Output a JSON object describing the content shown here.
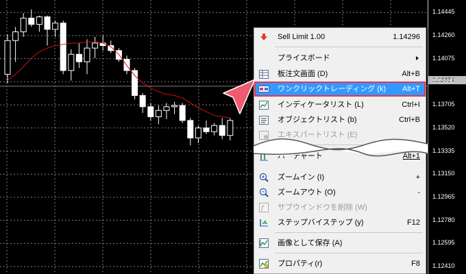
{
  "price_axis": {
    "ticks": [
      "1.14445",
      "1.14260",
      "1.14075",
      "1.13890",
      "1.13705",
      "1.13520",
      "1.13335",
      "1.13150",
      "1.12965",
      "1.12780",
      "1.12595",
      "1.12410"
    ],
    "current_price": "1.13854"
  },
  "chart_data": {
    "type": "candlestick",
    "candles": [
      {
        "o": 1.1395,
        "h": 1.1427,
        "l": 1.1388,
        "c": 1.1422
      },
      {
        "o": 1.1422,
        "h": 1.1433,
        "l": 1.1405,
        "c": 1.1429
      },
      {
        "o": 1.1429,
        "h": 1.1444,
        "l": 1.1425,
        "c": 1.144
      },
      {
        "o": 1.144,
        "h": 1.1447,
        "l": 1.1433,
        "c": 1.1435
      },
      {
        "o": 1.1435,
        "h": 1.1442,
        "l": 1.1429,
        "c": 1.1441
      },
      {
        "o": 1.1441,
        "h": 1.1442,
        "l": 1.1418,
        "c": 1.1431
      },
      {
        "o": 1.1431,
        "h": 1.1438,
        "l": 1.1425,
        "c": 1.1436
      },
      {
        "o": 1.1436,
        "h": 1.1438,
        "l": 1.1395,
        "c": 1.1398
      },
      {
        "o": 1.1398,
        "h": 1.1415,
        "l": 1.139,
        "c": 1.1411
      },
      {
        "o": 1.1411,
        "h": 1.142,
        "l": 1.14,
        "c": 1.1405
      },
      {
        "o": 1.1405,
        "h": 1.1423,
        "l": 1.1395,
        "c": 1.1416
      },
      {
        "o": 1.1416,
        "h": 1.1425,
        "l": 1.1408,
        "c": 1.142
      },
      {
        "o": 1.142,
        "h": 1.1426,
        "l": 1.1414,
        "c": 1.1418
      },
      {
        "o": 1.1418,
        "h": 1.1422,
        "l": 1.1412,
        "c": 1.1414
      },
      {
        "o": 1.1414,
        "h": 1.1416,
        "l": 1.1405,
        "c": 1.1407
      },
      {
        "o": 1.1407,
        "h": 1.141,
        "l": 1.1395,
        "c": 1.1398
      },
      {
        "o": 1.1398,
        "h": 1.14,
        "l": 1.1375,
        "c": 1.1378
      },
      {
        "o": 1.1378,
        "h": 1.138,
        "l": 1.1364,
        "c": 1.1369
      },
      {
        "o": 1.1369,
        "h": 1.1372,
        "l": 1.1358,
        "c": 1.1361
      },
      {
        "o": 1.1361,
        "h": 1.137,
        "l": 1.1355,
        "c": 1.1366
      },
      {
        "o": 1.1366,
        "h": 1.1372,
        "l": 1.1359,
        "c": 1.1369
      },
      {
        "o": 1.1369,
        "h": 1.1373,
        "l": 1.1363,
        "c": 1.137
      },
      {
        "o": 1.137,
        "h": 1.1372,
        "l": 1.1356,
        "c": 1.1358
      },
      {
        "o": 1.1358,
        "h": 1.136,
        "l": 1.1338,
        "c": 1.1344
      },
      {
        "o": 1.1344,
        "h": 1.1354,
        "l": 1.134,
        "c": 1.1352
      },
      {
        "o": 1.1352,
        "h": 1.1358,
        "l": 1.1347,
        "c": 1.1349
      },
      {
        "o": 1.1349,
        "h": 1.1356,
        "l": 1.1346,
        "c": 1.1354
      },
      {
        "o": 1.1354,
        "h": 1.136,
        "l": 1.1343,
        "c": 1.1346
      },
      {
        "o": 1.1346,
        "h": 1.136,
        "l": 1.1342,
        "c": 1.1358
      }
    ],
    "moving_average": [
      1.139,
      1.1395,
      1.1401,
      1.1408,
      1.1413,
      1.1416,
      1.1418,
      1.1419,
      1.142,
      1.142,
      1.1421,
      1.1421,
      1.142,
      1.1417,
      1.1411,
      1.1402,
      1.1394,
      1.1388,
      1.1384,
      1.1381,
      1.1379,
      1.1378,
      1.1376,
      1.1372,
      1.1368,
      1.1365,
      1.1362,
      1.1361,
      1.136
    ],
    "ylim": [
      1.1235,
      1.14545
    ],
    "grid": true
  },
  "colors": {
    "bull": "#ffffff",
    "bear": "#ffffff",
    "ma": "#d01010",
    "grid": "#7f7f7f",
    "price_line": "#808080",
    "menu_highlight": "#3399ff",
    "highlight_border": "#e8374a",
    "pointer": "#ef5b6e"
  },
  "menu": {
    "items": [
      {
        "icon": "red-down-arrow-icon",
        "label": "Sell Limit 1.00",
        "shortcut": "1.14296"
      },
      {
        "icon": "",
        "label": "プライスボード",
        "shortcut": "",
        "submenu": true
      },
      {
        "icon": "order-book-icon",
        "label": "板注文画面 (D)",
        "shortcut": "Alt+B"
      },
      {
        "icon": "one-click-trading-icon",
        "label": "ワンクリックトレーディング (k)",
        "shortcut": "Alt+T"
      },
      {
        "icon": "indicator-list-icon",
        "label": "インディケータリスト (L)",
        "shortcut": "Ctrl+I"
      },
      {
        "icon": "object-list-icon",
        "label": "オブジェクトリスト (b)",
        "shortcut": "Ctrl+B"
      },
      {
        "icon": "expert-list-icon",
        "label": "エキスパートリスト (E)",
        "shortcut": ""
      },
      {
        "icon": "bar-chart-icon",
        "label": "バーチャート",
        "shortcut": "Alt+1"
      },
      {
        "icon": "zoom-in-icon",
        "label": "ズームイン (I)",
        "shortcut": "+"
      },
      {
        "icon": "zoom-out-icon",
        "label": "ズームアウト (O)",
        "shortcut": "-"
      },
      {
        "icon": "subwindow-delete-icon",
        "label": "サブウインドウを削除 (W)",
        "shortcut": ""
      },
      {
        "icon": "step-by-step-icon",
        "label": "ステップバイステップ (y)",
        "shortcut": "F12"
      },
      {
        "icon": "save-image-icon",
        "label": "画像として保存 (A)",
        "shortcut": ""
      },
      {
        "icon": "properties-icon",
        "label": "プロパティ(r)",
        "shortcut": "F8"
      }
    ]
  }
}
